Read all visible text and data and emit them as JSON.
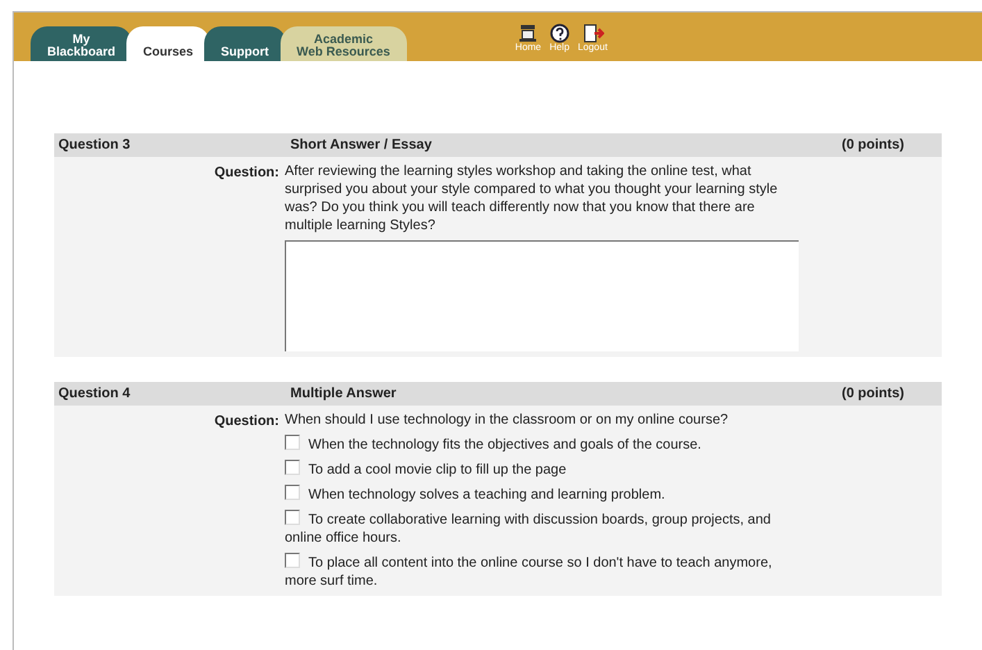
{
  "tabs": [
    {
      "label_lines": [
        "My",
        "Blackboard"
      ],
      "selected": false,
      "kind": "dark"
    },
    {
      "label_lines": [
        "Courses"
      ],
      "selected": true,
      "kind": "dark"
    },
    {
      "label_lines": [
        "Support"
      ],
      "selected": false,
      "kind": "dark"
    },
    {
      "label_lines": [
        "Academic",
        "Web Resources"
      ],
      "selected": false,
      "kind": "light"
    }
  ],
  "nav_icons": [
    {
      "kind": "home",
      "label": "Home"
    },
    {
      "kind": "help",
      "label": "Help"
    },
    {
      "kind": "logout",
      "label": "Logout"
    }
  ],
  "questions": [
    {
      "number": "Question 3",
      "type": "Short Answer / Essay",
      "points": "(0 points)",
      "prompt_label": "Question:",
      "kind": "essay",
      "text": "After reviewing the learning styles workshop and taking the online test, what surprised you about your style compared to what you thought your learning style was? Do you think you will teach differently now that you know that there are multiple learning Styles?"
    },
    {
      "number": "Question 4",
      "type": "Multiple Answer",
      "points": "(0 points)",
      "prompt_label": "Question:",
      "kind": "multiple",
      "text": "When should I use technology in the classroom or on my online course?",
      "answers": [
        {
          "label": "When the technology fits the objectives and goals of the course.",
          "checked": false
        },
        {
          "label": "To add a cool movie clip to fill up the page",
          "checked": false
        },
        {
          "label": "When technology solves a teaching and learning problem.",
          "checked": false
        },
        {
          "label": "To create collaborative learning with discussion boards, group projects, and online office hours.",
          "checked": false
        },
        {
          "label": "To place all content into the online course so I don't have to teach anymore, more surf time.",
          "checked": false
        }
      ]
    }
  ]
}
